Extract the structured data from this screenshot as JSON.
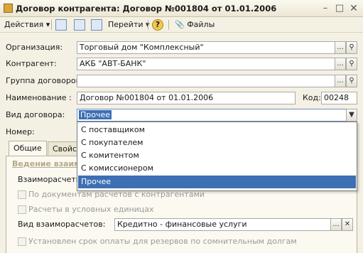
{
  "window": {
    "title": "Договор контрагента: Договор №001804 от 01.01.2006",
    "minimize_icon": "minimize-icon",
    "maximize_icon": "maximize-icon",
    "close_icon": "close-icon"
  },
  "toolbar": {
    "actions_label": "Действия",
    "goto_label": "Перейти",
    "files_label": "Файлы",
    "help_label": "?"
  },
  "form": {
    "org_label": "Организация:",
    "org_value": "Торговый дом \"Комплексный\"",
    "contractor_label": "Контрагент:",
    "contractor_value": "АКБ \"АВТ-БАНК\"",
    "group_label": "Группа договоров:",
    "group_value": "",
    "name_label": "Наименование :",
    "name_value": "Договор №001804 от 01.01.2006",
    "code_label": "Код:",
    "code_value": "00248",
    "type_label": "Вид договора:",
    "type_value": "Прочее",
    "number_label": "Номер:",
    "select_button": "...",
    "open_button": "Q"
  },
  "dropdown": {
    "options": [
      "С поставщиком",
      "С покупателем",
      "С комитентом",
      "С комиссионером",
      "Прочее"
    ],
    "selected_index": 4
  },
  "tabs": [
    "Общие",
    "Свойс"
  ],
  "panel": {
    "section_title": "Ведение взаим",
    "settlements_label": "Взаиморасчеты",
    "by_docs_label": "По документам расчетов с контрагентами",
    "conv_units_label": "Расчеты в условных единицах",
    "settlement_type_label": "Вид взаиморасчетов:",
    "settlement_type_value": "Кредитно - финансовые услуги",
    "payment_term_label": "Установлен срок оплаты для резервов по сомнительным долгам",
    "clear_button": "✕"
  }
}
